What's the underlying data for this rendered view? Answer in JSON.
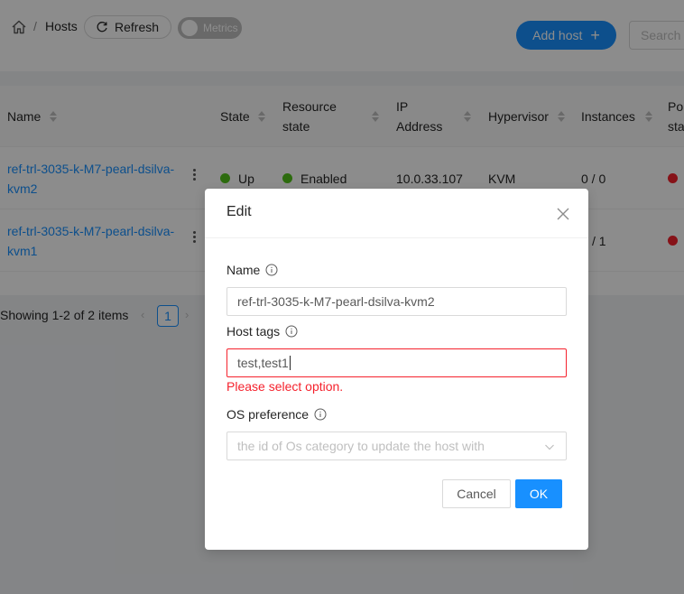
{
  "header": {
    "breadcrumb_home_icon": "home-icon",
    "breadcrumb_separator": "/",
    "breadcrumb_current": "Hosts",
    "refresh_label": "Refresh",
    "metrics_label": "Metrics",
    "metrics_enabled": false,
    "add_host_label": "Add host",
    "search_placeholder": "Search"
  },
  "table": {
    "columns": {
      "name": "Name",
      "state": "State",
      "resource_state_1": "Resource",
      "resource_state_2": "state",
      "ip_1": "IP",
      "ip_2": "Address",
      "hypervisor": "Hypervisor",
      "instances": "Instances",
      "power_1": "Po",
      "power_2": "sta"
    },
    "rows": [
      {
        "name_1": "ref-trl-3035-k-M7-pearl-dsilva-",
        "name_2": "kvm2",
        "state": "Up",
        "state_color": "#52c41a",
        "resource_state": "Enabled",
        "resource_state_color": "#52c41a",
        "ip": "10.0.33.107",
        "hypervisor": "KVM",
        "instances": "0 / 0",
        "power_color": "#f5222d"
      },
      {
        "name_1": "ref-trl-3035-k-M7-pearl-dsilva-",
        "name_2": "kvm1",
        "instances": "/ 1",
        "power_color": "#f5222d"
      }
    ]
  },
  "pagination": {
    "summary": "Showing 1-2 of 2 items",
    "prev": "‹",
    "current_page": "1",
    "next": "›"
  },
  "modal": {
    "title": "Edit",
    "name_label": "Name",
    "name_value": "ref-trl-3035-k-M7-pearl-dsilva-kvm2",
    "host_tags_label": "Host tags",
    "host_tags_value": "test,test1",
    "host_tags_error": "Please select option.",
    "os_pref_label": "OS preference",
    "os_pref_placeholder": "the id of Os category to update the host with",
    "cancel_label": "Cancel",
    "ok_label": "OK"
  },
  "colors": {
    "primary": "#1890ff",
    "error": "#f5222d",
    "success": "#52c41a"
  }
}
